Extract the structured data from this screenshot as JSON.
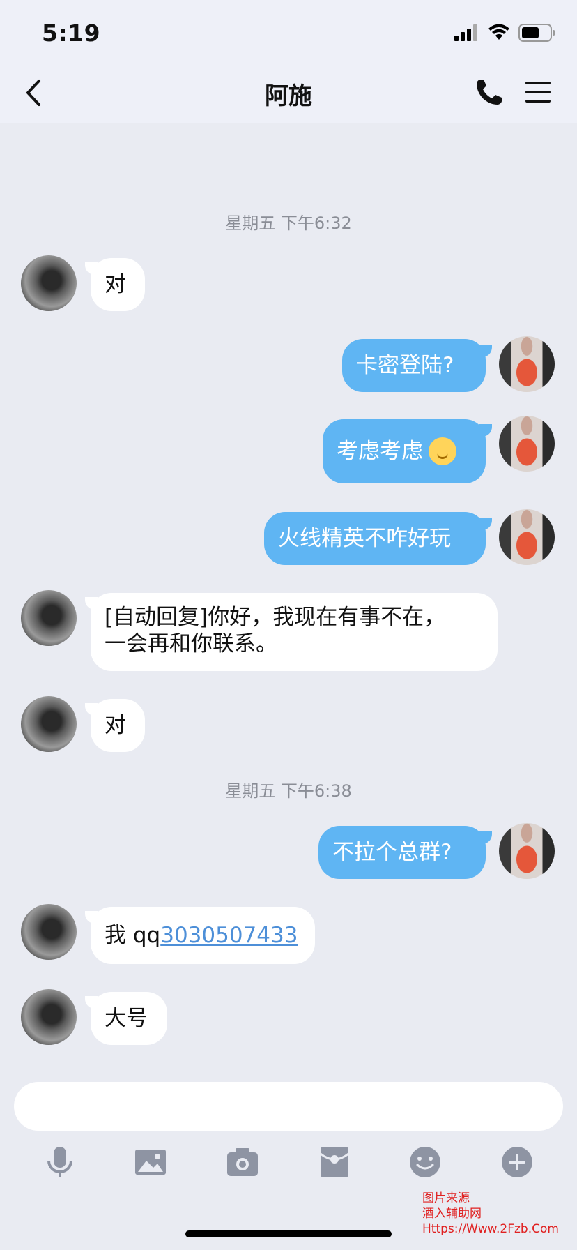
{
  "status_bar": {
    "time": "5:19"
  },
  "header": {
    "title": "阿施"
  },
  "messages": [
    {
      "type": "timestamp",
      "text": "星期五 下午6:32"
    },
    {
      "side": "left",
      "text": "对"
    },
    {
      "side": "right",
      "text": "卡密登陆?"
    },
    {
      "side": "right",
      "text": "考虑考虑",
      "emoji": "thinking-emoji"
    },
    {
      "side": "right",
      "text": "火线精英不咋好玩"
    },
    {
      "side": "left",
      "line1": "[自动回复]你好，我现在有事不在，",
      "line2": "一会再和你联系。"
    },
    {
      "side": "left",
      "text": "对"
    },
    {
      "type": "timestamp",
      "text": "星期五 下午6:38"
    },
    {
      "side": "right",
      "text": "不拉个总群?"
    },
    {
      "side": "left",
      "prefix": "我 qq",
      "link": "3030507433"
    },
    {
      "side": "left",
      "text": "大号"
    }
  ],
  "input": {
    "placeholder": ""
  },
  "toolbar": [
    "microphone-icon",
    "image-icon",
    "camera-icon",
    "red-packet-icon",
    "emoji-icon",
    "plus-icon"
  ],
  "watermark": {
    "line1": "图片来源",
    "line2": "酒入辅助网",
    "line3": "Https://Www.2Fzb.Com"
  },
  "colors": {
    "bubble_out": "#5fb5f3",
    "bubble_in": "#ffffff",
    "background": "#e9ebf2",
    "link": "#4d8fd8",
    "watermark": "#e02020"
  }
}
